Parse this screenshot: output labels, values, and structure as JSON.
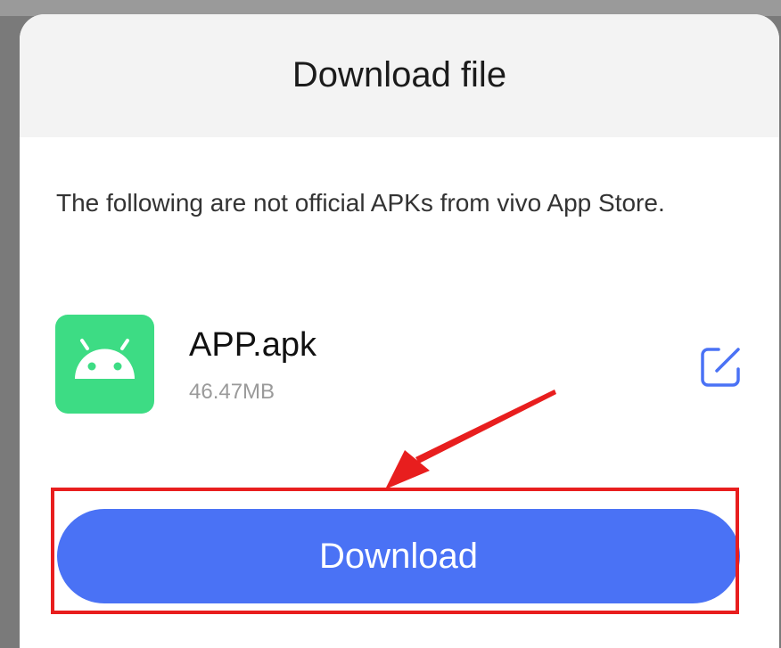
{
  "dialog": {
    "title": "Download file",
    "warning": "The following are not official APKs from vivo App Store."
  },
  "file": {
    "name": "APP.apk",
    "size": "46.47MB",
    "icon": "android-icon",
    "edit_icon": "edit-icon"
  },
  "actions": {
    "download_label": "Download"
  },
  "colors": {
    "header_bg": "#f3f3f3",
    "app_icon_bg": "#3ddc84",
    "accent": "#4a72f5",
    "annotation": "#e81e1e"
  }
}
